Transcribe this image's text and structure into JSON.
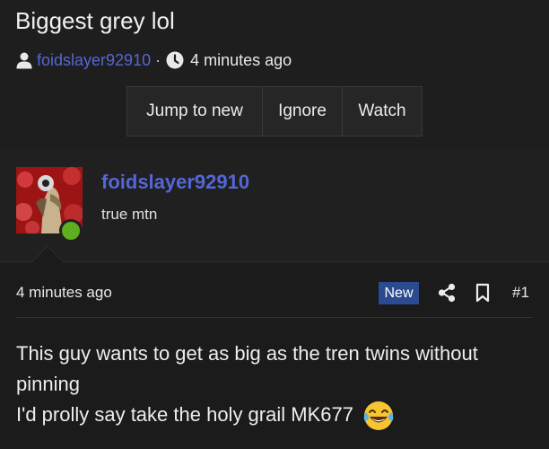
{
  "thread": {
    "title": "Biggest grey lol",
    "author": "foidslayer92910",
    "separator": "·",
    "time": "4 minutes ago"
  },
  "actions": {
    "jump_label": "Jump to new",
    "ignore_label": "Ignore",
    "watch_label": "Watch"
  },
  "post": {
    "username": "foidslayer92910",
    "user_title": "true mtn",
    "time": "4 minutes ago",
    "badge": "New",
    "number": "#1",
    "body_line1": "This guy wants to get as big as the tren twins without pinning",
    "body_line2": "I'd prolly say take the holy grail MK677",
    "online_color": "#5fae1f",
    "emoji": "crying-laughing-emoji"
  },
  "colors": {
    "link": "#5566d6",
    "badge_bg": "#2c4a8f",
    "background": "#1b1b1b"
  }
}
